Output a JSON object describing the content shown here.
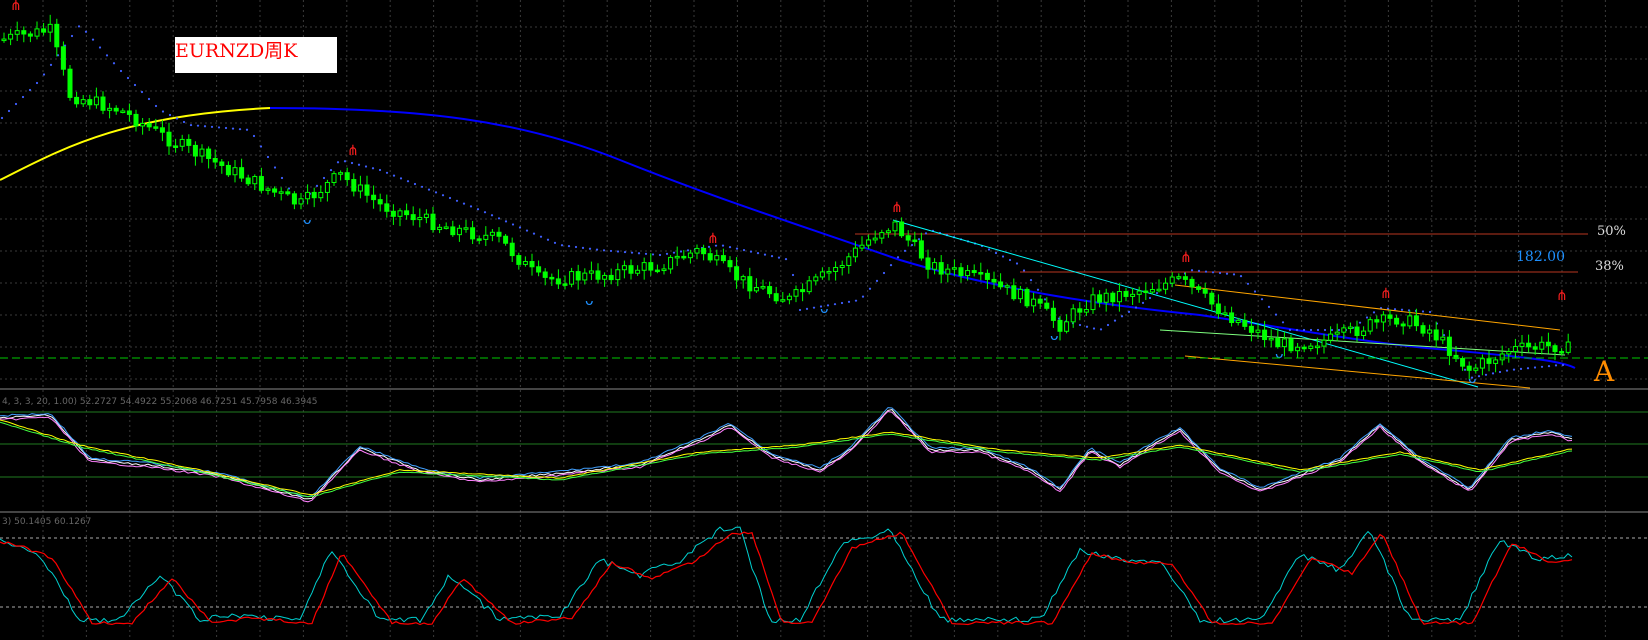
{
  "symbol_label": "EURNZD周K",
  "fib_levels": [
    "50%",
    "38%"
  ],
  "target_value": "182.00",
  "marker_label": "A",
  "indicator1_info": "4, 3, 3, 20, 1.00) 52.2727 54.4922 55.2068 46.7251 45.7958 46.3945",
  "indicator2_info": "3) 50.1405 60.1267",
  "colors": {
    "background": "#000000",
    "grid": "#3a3a3a",
    "candle_up": "#00ff00",
    "candle_down": "#ffffff",
    "ma_slow": "#0000ff",
    "ma_yellow": "#ffff00",
    "psar": "#3f5fff",
    "fractal_up": "#ff2020",
    "fractal_down": "#1e90ff",
    "fib_line": "#b8361f",
    "trend_cyan": "#00ffff",
    "channel": "#ffa500",
    "current_price": "#00c800",
    "kdj_white": "#ffffff",
    "kdj_pink": "#ff80ff",
    "kdj_blue": "#40a0ff",
    "kdj_yellow": "#ffff00",
    "kdj_green": "#40ff40",
    "stoch_red": "#ff0000",
    "stoch_cyan": "#00d0d0"
  },
  "chart_data": [
    {
      "type": "candlestick",
      "title": "EURNZD周K",
      "description": "Weekly EURNZD price panel with moving averages, parabolic SAR, fractals, Fibonacci levels, trendlines and channel",
      "annotations": [
        "50%",
        "38%",
        "182.00",
        "A"
      ],
      "ylim": [
        0,
        1
      ]
    },
    {
      "type": "line",
      "title": "4, 3, 3, 20, 1.00) 52.2727 54.4922 55.2068 46.7251 45.7958 46.3945",
      "ylim": [
        0,
        100
      ]
    },
    {
      "type": "line",
      "title": "3) 50.1405 60.1267",
      "ylim": [
        0,
        100
      ]
    }
  ]
}
